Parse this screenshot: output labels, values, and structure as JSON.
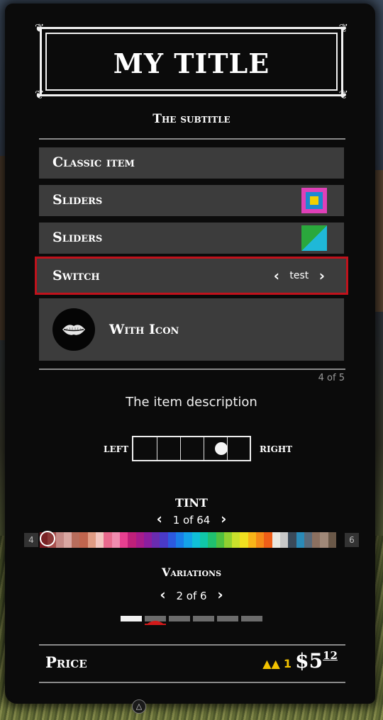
{
  "menu": {
    "title": "MY TITLE",
    "subtitle": "The subtitle",
    "items": [
      {
        "label": "Classic item"
      },
      {
        "label": "Sliders",
        "swatch_colors": [
          "#e040b8",
          "#1e88d0",
          "#f2d000"
        ]
      },
      {
        "label": "Sliders",
        "swatch_colors": [
          "#2aa83c",
          "#1fb8d8"
        ]
      },
      {
        "label": "Switch",
        "value": "test",
        "selected": true
      },
      {
        "label": "With Icon",
        "icon": "lips-icon"
      }
    ],
    "counter": "4 of 5",
    "description": "The item description"
  },
  "grid": {
    "left_label": "LEFT",
    "right_label": "RIGHT",
    "level": 0.75
  },
  "tint": {
    "title": "TINT",
    "pager": "1 of 64",
    "left_badge": "4",
    "right_badge": "6",
    "palette": [
      "#7a1a22",
      "#a8504e",
      "#c58a86",
      "#d9a7a2",
      "#b86d5c",
      "#c0654e",
      "#e09c84",
      "#f2c6c0",
      "#e86a8e",
      "#f08cb0",
      "#e84090",
      "#c0207a",
      "#a81c8c",
      "#8c1ea0",
      "#6a2cb0",
      "#4a3ac8",
      "#2c5ae0",
      "#1a7ee8",
      "#14a2e8",
      "#10c0d8",
      "#10c8a8",
      "#20c070",
      "#50c040",
      "#90d030",
      "#c8e02c",
      "#f0e020",
      "#f8b418",
      "#f48a18",
      "#ee5e18",
      "#e8e8e0",
      "#c8c8c8",
      "#3a4a5a",
      "#2a8ab8",
      "#5a6a7a",
      "#8c7060",
      "#a08878",
      "#6a5848"
    ]
  },
  "variations": {
    "title": "Variations",
    "pager": "2 of 6",
    "count": 6,
    "current": 2
  },
  "price": {
    "label": "Price",
    "gold": "1",
    "dollars": "$5",
    "cents": "12"
  },
  "footer": {
    "button_glyph": "△"
  }
}
